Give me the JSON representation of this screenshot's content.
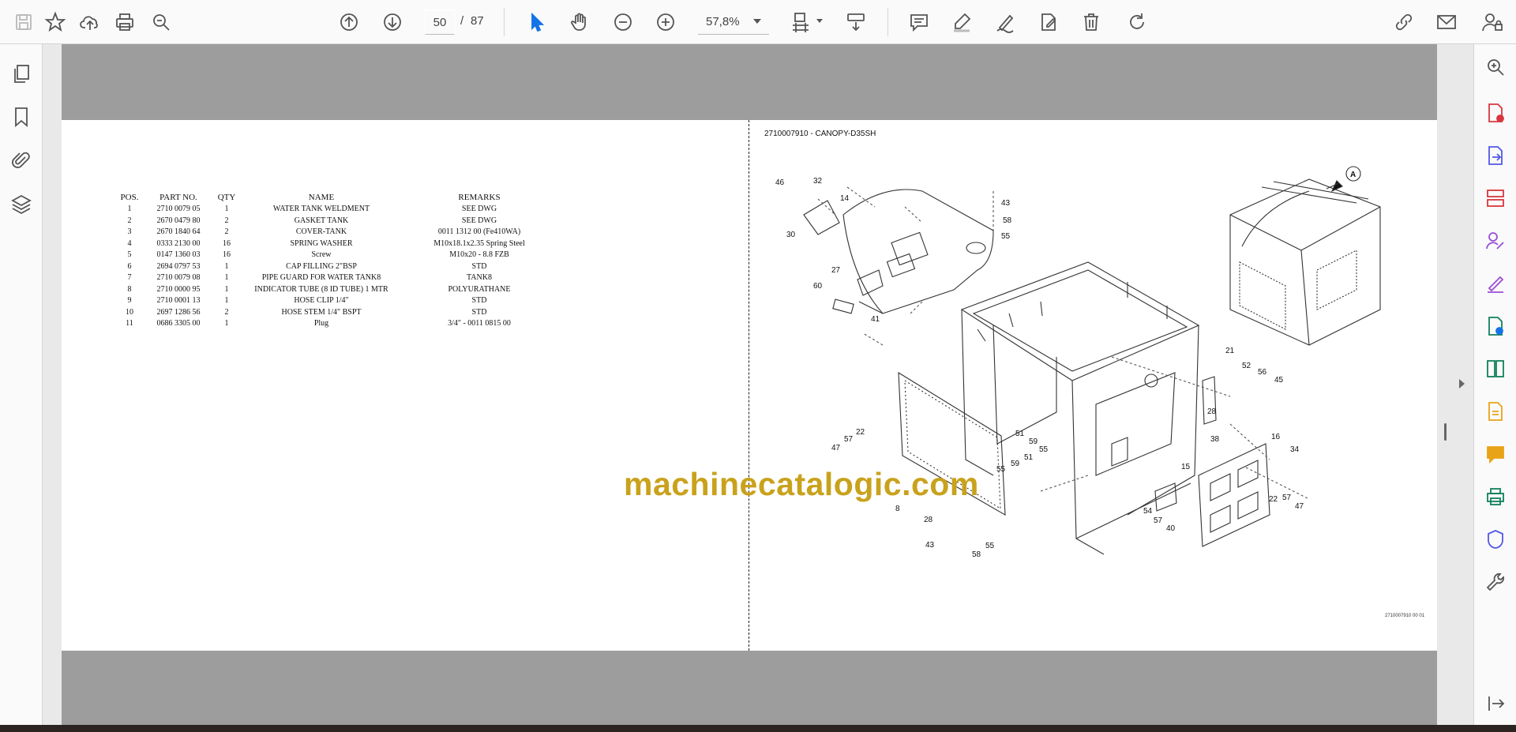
{
  "toolbar": {
    "page_current": "50",
    "page_separator": "/",
    "page_total": "87",
    "zoom": "57,8%"
  },
  "parts_table": {
    "headers": [
      "POS.",
      "PART NO.",
      "QTY",
      "NAME",
      "REMARKS"
    ],
    "rows": [
      {
        "pos": "1",
        "part": "2710 0079 05",
        "qty": "1",
        "name": "WATER TANK WELDMENT",
        "remarks": "SEE DWG"
      },
      {
        "pos": "2",
        "part": "2670 0479 80",
        "qty": "2",
        "name": "GASKET TANK",
        "remarks": "SEE DWG"
      },
      {
        "pos": "3",
        "part": "2670 1840 64",
        "qty": "2",
        "name": "COVER-TANK",
        "remarks": "0011 1312 00 (Fe410WA)"
      },
      {
        "pos": "4",
        "part": "0333 2130 00",
        "qty": "16",
        "name": "SPRING WASHER",
        "remarks": "M10x18.1x2.35 Spring Steel"
      },
      {
        "pos": "5",
        "part": "0147 1360 03",
        "qty": "16",
        "name": "Screw",
        "remarks": "M10x20 - 8.8 FZB"
      },
      {
        "pos": "6",
        "part": "2694 0797 53",
        "qty": "1",
        "name": "CAP FILLING 2\"BSP",
        "remarks": "STD"
      },
      {
        "pos": "7",
        "part": "2710 0079 08",
        "qty": "1",
        "name": "PIPE GUARD FOR WATER TANK8",
        "remarks": "TANK8"
      },
      {
        "pos": "8",
        "part": "2710 0000 95",
        "qty": "1",
        "name": "INDICATOR TUBE (8 ID TUBE) 1 MTR",
        "remarks": "POLYURATHANE"
      },
      {
        "pos": "9",
        "part": "2710 0001 13",
        "qty": "1",
        "name": "HOSE CLIP 1/4\"",
        "remarks": "STD"
      },
      {
        "pos": "10",
        "part": "2697 1286 56",
        "qty": "2",
        "name": "HOSE STEM 1/4\" BSPT",
        "remarks": "STD"
      },
      {
        "pos": "11",
        "part": "0686 3305 00",
        "qty": "1",
        "name": "Plug",
        "remarks": "3/4\" - 0011 0815 00"
      }
    ]
  },
  "diagram": {
    "title": "2710007910 - CANOPY-D35SH",
    "reference": "2710007910 00 01",
    "view_label": "A",
    "callouts": [
      "46",
      "32",
      "14",
      "30",
      "43",
      "58",
      "55",
      "27",
      "60",
      "41",
      "21",
      "52",
      "56",
      "45",
      "28",
      "38",
      "16",
      "34",
      "51",
      "59",
      "55",
      "47",
      "57",
      "22",
      "55",
      "59",
      "51",
      "15",
      "8",
      "54",
      "57",
      "40",
      "22",
      "57",
      "47",
      "28",
      "43",
      "58",
      "55"
    ]
  },
  "watermark": "machinecatalogic.com",
  "colors": {
    "accent_blue": "#1473e6",
    "watermark_gold": "#c9a21c",
    "page_grey": "#9d9d9d"
  }
}
